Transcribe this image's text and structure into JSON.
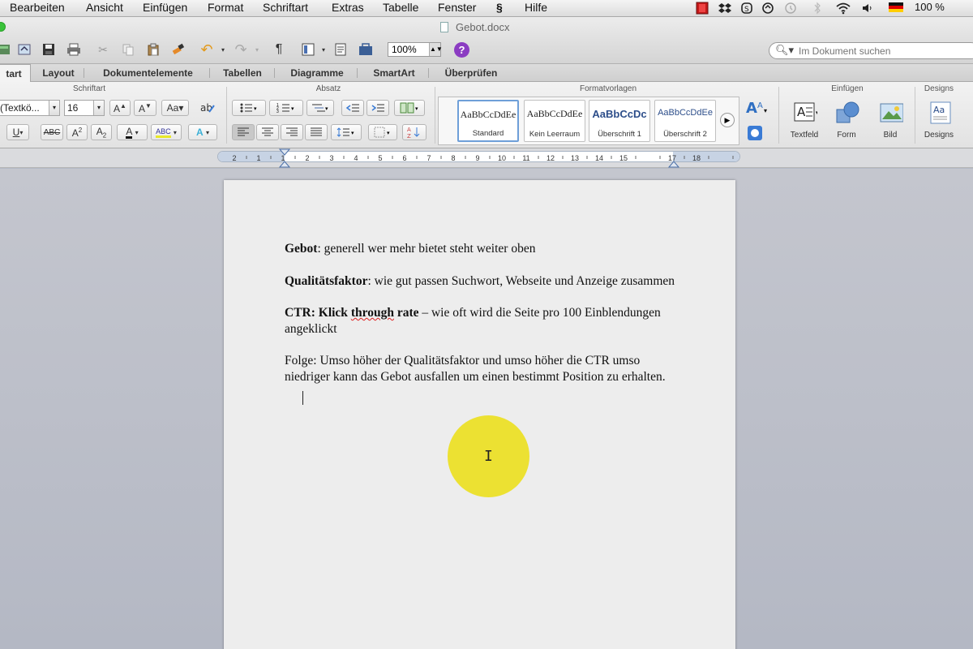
{
  "menubar": {
    "items": [
      "Bearbeiten",
      "Ansicht",
      "Einfügen",
      "Format",
      "Schriftart",
      "Extras",
      "Tabelle",
      "Fenster",
      "Hilfe"
    ],
    "battery": "100 %",
    "tray_icons": [
      "record-icon",
      "dropbox-icon",
      "skype-icon",
      "sync-icon",
      "timemachine-icon",
      "bluetooth-icon",
      "wifi-icon",
      "volume-icon",
      "german-flag-icon"
    ]
  },
  "window": {
    "title": "Gebot.docx"
  },
  "toolbar": {
    "zoom": "100%",
    "search_placeholder": "Im Dokument suchen",
    "pilcrow": "¶"
  },
  "ribbon_tabs": [
    "tart",
    "Layout",
    "Dokumentelemente",
    "Tabellen",
    "Diagramme",
    "SmartArt",
    "Überprüfen"
  ],
  "ribbon": {
    "groups": {
      "font": "Schriftart",
      "paragraph": "Absatz",
      "styles": "Formatvorlagen",
      "insert": "Einfügen",
      "designs": "Designs"
    },
    "font_name": "(Textkö...",
    "font_size": "16",
    "styles": [
      {
        "preview": "AaBbCcDdEe",
        "name": "Standard"
      },
      {
        "preview": "AaBbCcDdEe",
        "name": "Kein Leerraum"
      },
      {
        "preview": "AaBbCcDc",
        "name": "Überschrift 1"
      },
      {
        "preview": "AaBbCcDdEe",
        "name": "Überschrift 2"
      }
    ],
    "insert_tools": [
      "Textfeld",
      "Form",
      "Bild"
    ],
    "designs_label": "Designs",
    "accent": "#6e9fd8"
  },
  "ruler": {
    "labels": [
      "2",
      "1",
      "1",
      "2",
      "3",
      "4",
      "5",
      "6",
      "7",
      "8",
      "9",
      "10",
      "11",
      "12",
      "13",
      "14",
      "15",
      "17",
      "18"
    ]
  },
  "document": {
    "p1_bold": "Gebot",
    "p1_rest": ": generell wer mehr bietet steht weiter oben",
    "p2_bold": "Qualitätsfaktor",
    "p2_rest": ": wie gut passen Suchwort, Webseite und Anzeige zusammen",
    "p3_bold_a": "CTR: Klick ",
    "p3_bold_spell": "through",
    "p3_bold_b": " rate",
    "p3_rest": " – wie oft wird die Seite pro 100 Einblendungen angeklickt",
    "p4": "Folge: Umso höher der Qualitätsfaktor und umso höher die CTR umso niedriger kann das Gebot ausfallen um einen bestimmt Position zu erhalten."
  },
  "colors": {
    "highlight": "#ece022",
    "help": "#8b3cc2"
  }
}
